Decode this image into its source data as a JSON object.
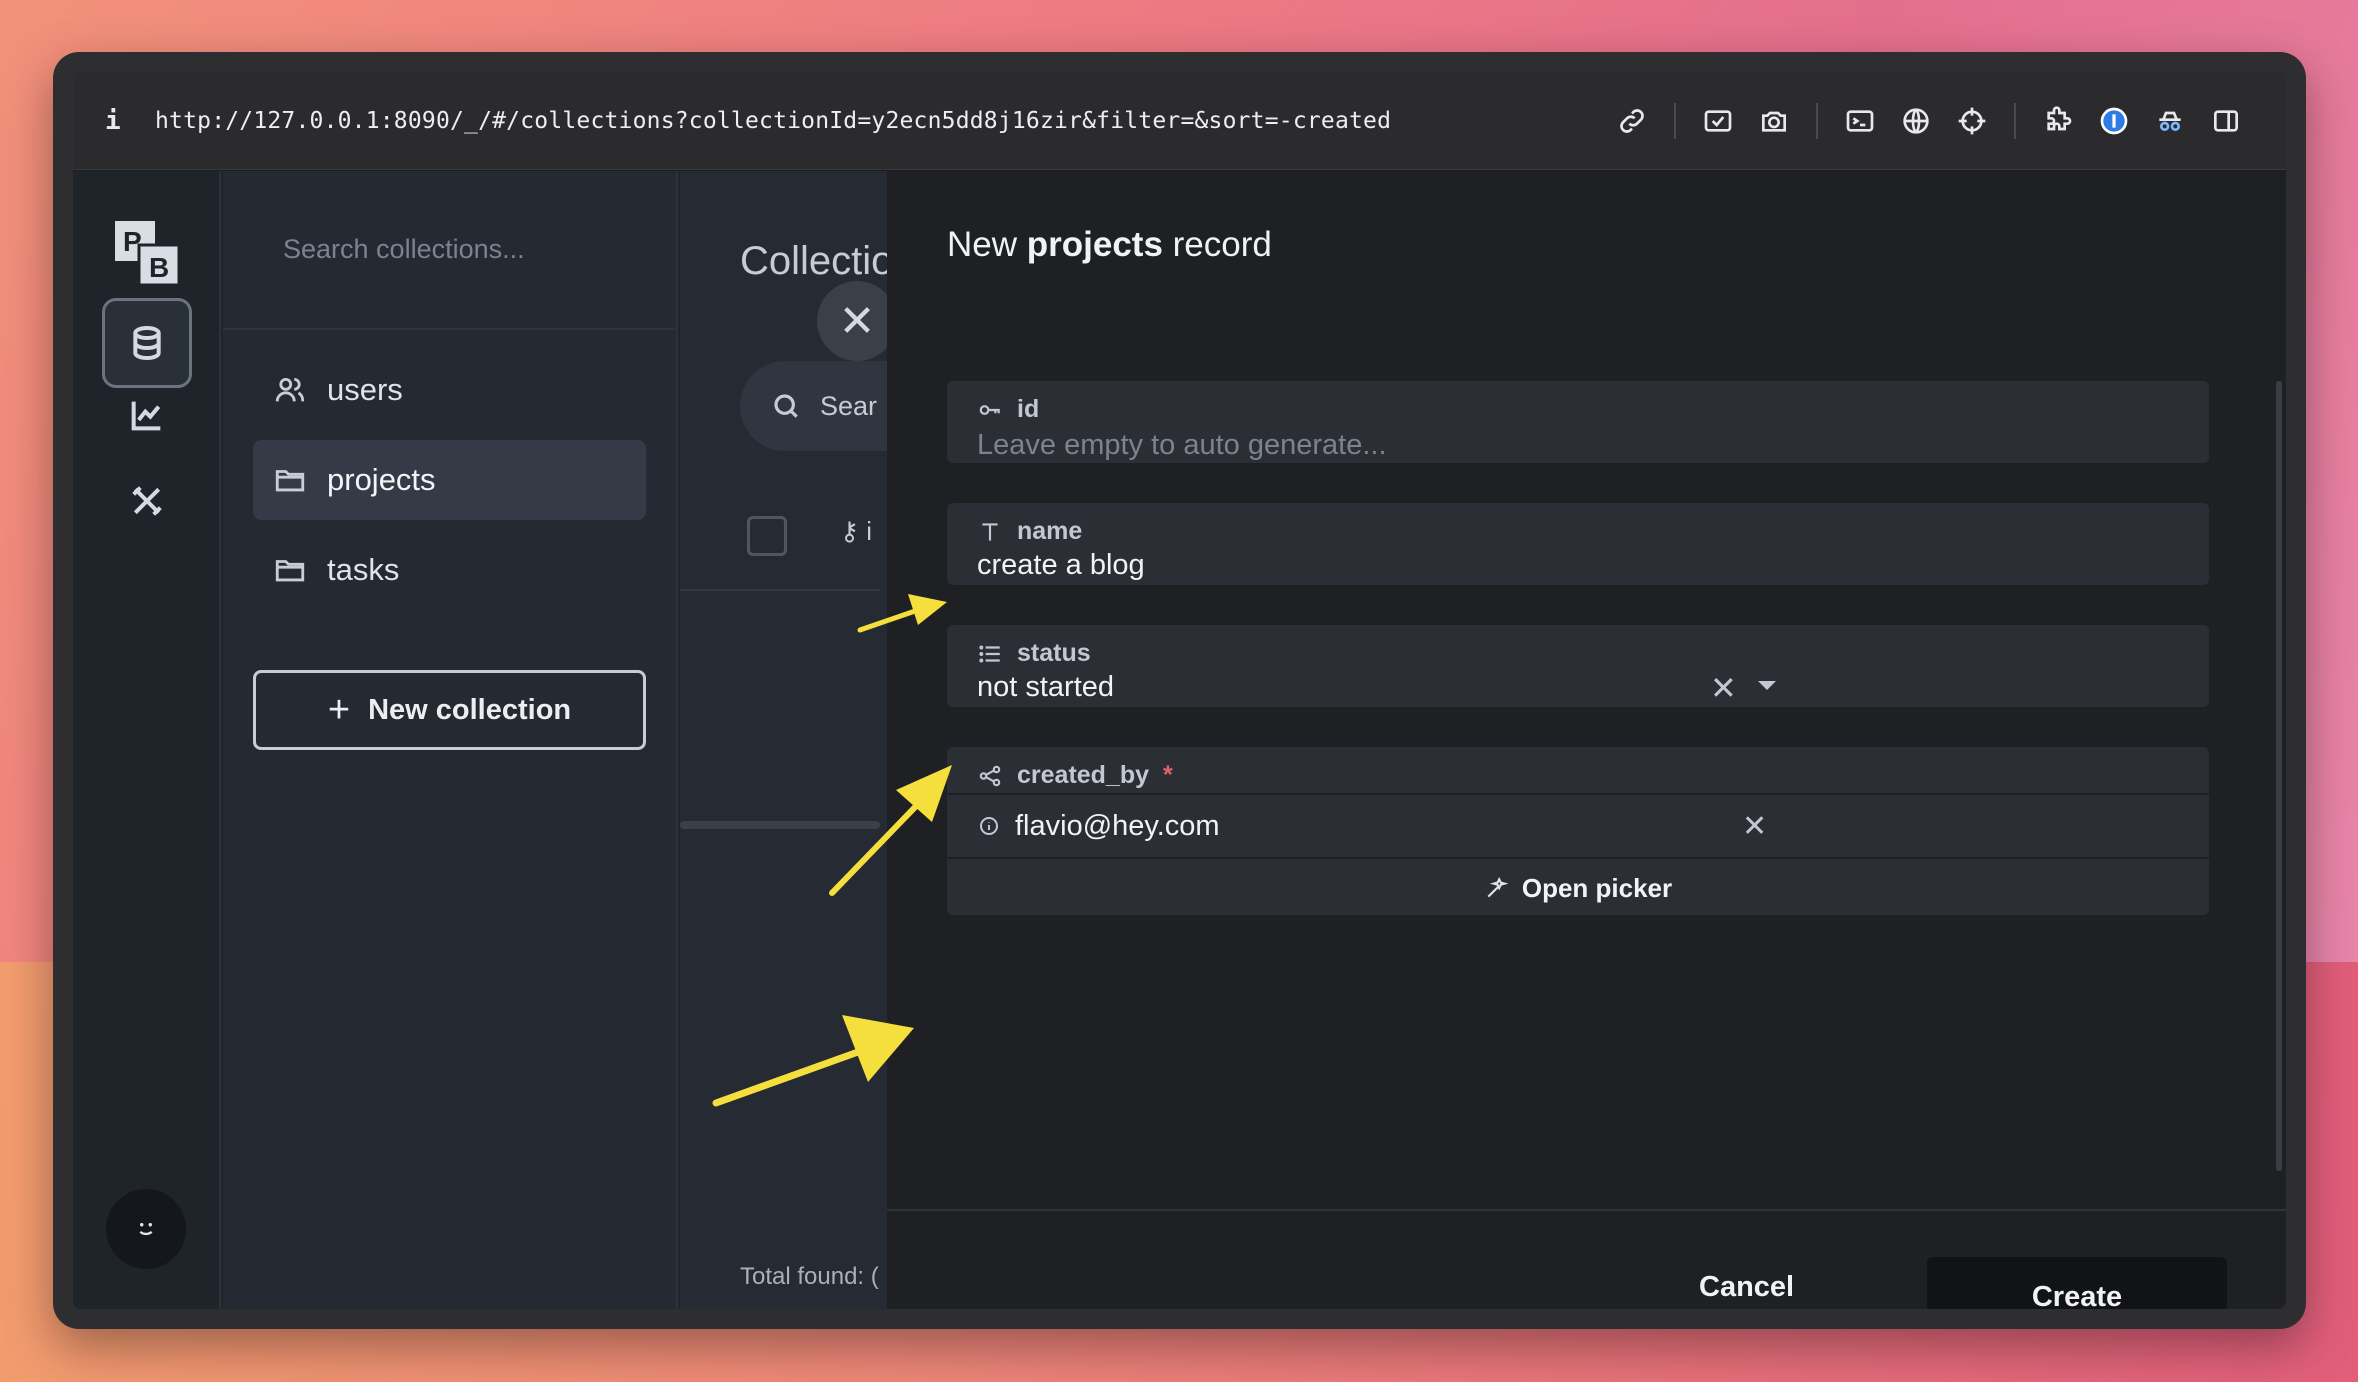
{
  "browser": {
    "info_label": "i",
    "url": "http://127.0.0.1:8090/_/#/collections?collectionId=y2ecn5dd8j16zir&filter=&sort=-created"
  },
  "sidebar": {
    "search_placeholder": "Search collections...",
    "collections": [
      {
        "label": "users",
        "icon": "users-icon"
      },
      {
        "label": "projects",
        "icon": "folder-icon",
        "active": true
      },
      {
        "label": "tasks",
        "icon": "folder-icon"
      }
    ],
    "new_collection_label": "New collection",
    "new_collection_plus": "+"
  },
  "main": {
    "title_partial": "Collectio",
    "search_partial": "Sear",
    "column_partial": "i",
    "total_found_partial": "Total found: (",
    "close_symbol": "✕"
  },
  "drawer": {
    "title_prefix": "New ",
    "title_collection": "projects",
    "title_suffix": " record",
    "fields": {
      "id": {
        "label": "id",
        "placeholder": "Leave empty to auto generate..."
      },
      "name": {
        "label": "name",
        "value": "create a blog"
      },
      "status": {
        "label": "status",
        "value": "not started",
        "clear": "✕"
      },
      "created_by": {
        "label": "created_by",
        "required_mark": "*",
        "value": "flavio@hey.com",
        "clear": "✕",
        "picker_label": "Open picker"
      }
    },
    "cancel_label": "Cancel",
    "create_label": "Create"
  },
  "avatar_face": "̤˘",
  "colors": {
    "annotation_arrow": "#f5df3c",
    "drawer_bg": "#1f2024",
    "field_bg": "#2b2e34"
  }
}
